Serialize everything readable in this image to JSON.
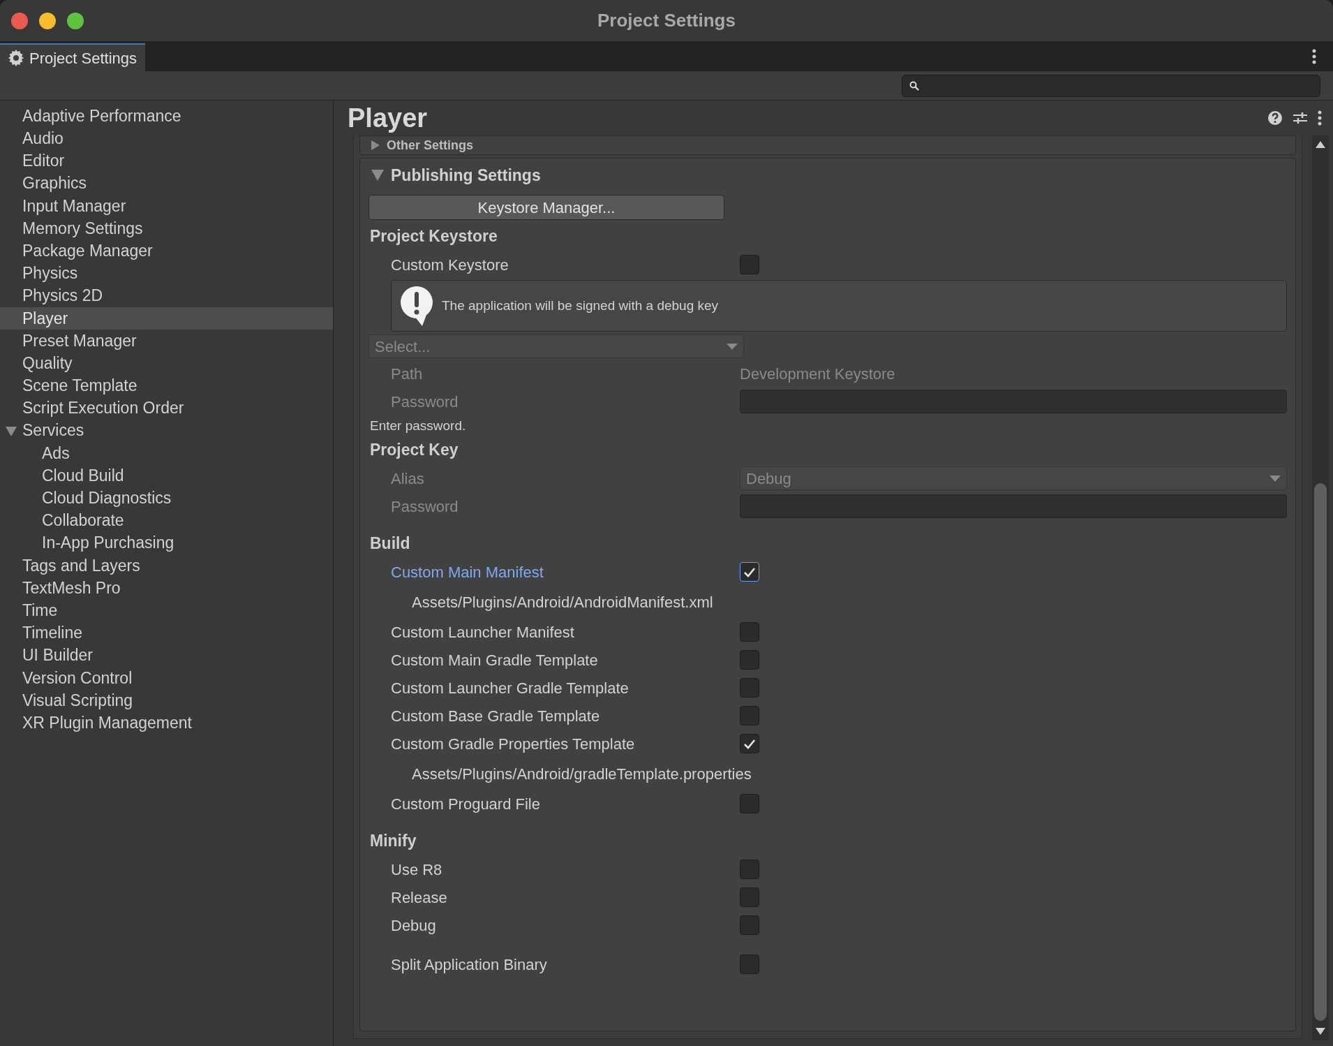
{
  "window": {
    "title": "Project Settings"
  },
  "tab": {
    "label": "Project Settings",
    "selected": true
  },
  "sidebar": {
    "items": [
      {
        "label": "Adaptive Performance",
        "selected": false
      },
      {
        "label": "Audio",
        "selected": false
      },
      {
        "label": "Editor",
        "selected": false
      },
      {
        "label": "Graphics",
        "selected": false
      },
      {
        "label": "Input Manager",
        "selected": false
      },
      {
        "label": "Memory Settings",
        "selected": false
      },
      {
        "label": "Package Manager",
        "selected": false
      },
      {
        "label": "Physics",
        "selected": false
      },
      {
        "label": "Physics 2D",
        "selected": false
      },
      {
        "label": "Player",
        "selected": true
      },
      {
        "label": "Preset Manager",
        "selected": false
      },
      {
        "label": "Quality",
        "selected": false
      },
      {
        "label": "Scene Template",
        "selected": false
      },
      {
        "label": "Script Execution Order",
        "selected": false
      },
      {
        "label": "Services",
        "selected": false,
        "expanded": true,
        "children": [
          {
            "label": "Ads",
            "selected": false
          },
          {
            "label": "Cloud Build",
            "selected": false
          },
          {
            "label": "Cloud Diagnostics",
            "selected": false
          },
          {
            "label": "Collaborate",
            "selected": false
          },
          {
            "label": "In-App Purchasing",
            "selected": false
          }
        ]
      },
      {
        "label": "Tags and Layers",
        "selected": false
      },
      {
        "label": "TextMesh Pro",
        "selected": false
      },
      {
        "label": "Time",
        "selected": false
      },
      {
        "label": "Timeline",
        "selected": false
      },
      {
        "label": "UI Builder",
        "selected": false
      },
      {
        "label": "Version Control",
        "selected": false
      },
      {
        "label": "Visual Scripting",
        "selected": false
      },
      {
        "label": "XR Plugin Management",
        "selected": false
      }
    ]
  },
  "panel": {
    "title": "Player",
    "sections": [
      {
        "title": "Other Settings",
        "expanded": false
      },
      {
        "title": "Publishing Settings",
        "expanded": true,
        "rows": [
          {
            "kind": "button",
            "label": "Keystore Manager..."
          },
          {
            "kind": "heading",
            "label": "Project Keystore"
          },
          {
            "kind": "checkbox",
            "label": "Custom Keystore",
            "checked": false,
            "modified": false
          },
          {
            "kind": "helpbox",
            "text": "The application will be signed with a debug key"
          },
          {
            "kind": "select",
            "value": "Select...",
            "disabled": true
          },
          {
            "kind": "text",
            "label": "Path",
            "value": "Development Keystore",
            "disabled": true
          },
          {
            "kind": "field",
            "label": "Password",
            "disabled": true
          },
          {
            "kind": "note",
            "text": "Enter password."
          },
          {
            "kind": "heading",
            "label": "Project Key"
          },
          {
            "kind": "dropdown",
            "label": "Alias",
            "value": "Debug",
            "disabled": true
          },
          {
            "kind": "field",
            "label": "Password",
            "disabled": true
          },
          {
            "kind": "heading",
            "label": "Build"
          },
          {
            "kind": "checkbox",
            "label": "Custom Main Manifest",
            "checked": true,
            "modified": true
          },
          {
            "kind": "path",
            "text": "Assets/Plugins/Android/AndroidManifest.xml"
          },
          {
            "kind": "checkbox",
            "label": "Custom Launcher Manifest",
            "checked": false,
            "modified": false
          },
          {
            "kind": "checkbox",
            "label": "Custom Main Gradle Template",
            "checked": false,
            "modified": false
          },
          {
            "kind": "checkbox",
            "label": "Custom Launcher Gradle Template",
            "checked": false,
            "modified": false
          },
          {
            "kind": "checkbox",
            "label": "Custom Base Gradle Template",
            "checked": false,
            "modified": false
          },
          {
            "kind": "checkbox",
            "label": "Custom Gradle Properties Template",
            "checked": true,
            "modified": false
          },
          {
            "kind": "path",
            "text": "Assets/Plugins/Android/gradleTemplate.properties"
          },
          {
            "kind": "checkbox",
            "label": "Custom Proguard File",
            "checked": false,
            "modified": false
          },
          {
            "kind": "heading",
            "label": "Minify"
          },
          {
            "kind": "checkbox",
            "label": "Use R8",
            "checked": false,
            "modified": false
          },
          {
            "kind": "checkbox",
            "label": "Release",
            "checked": false,
            "modified": false
          },
          {
            "kind": "checkbox",
            "label": "Debug",
            "checked": false,
            "modified": false
          },
          {
            "kind": "checkbox",
            "label": "Split Application Binary",
            "checked": false,
            "modified": false
          }
        ]
      }
    ]
  }
}
